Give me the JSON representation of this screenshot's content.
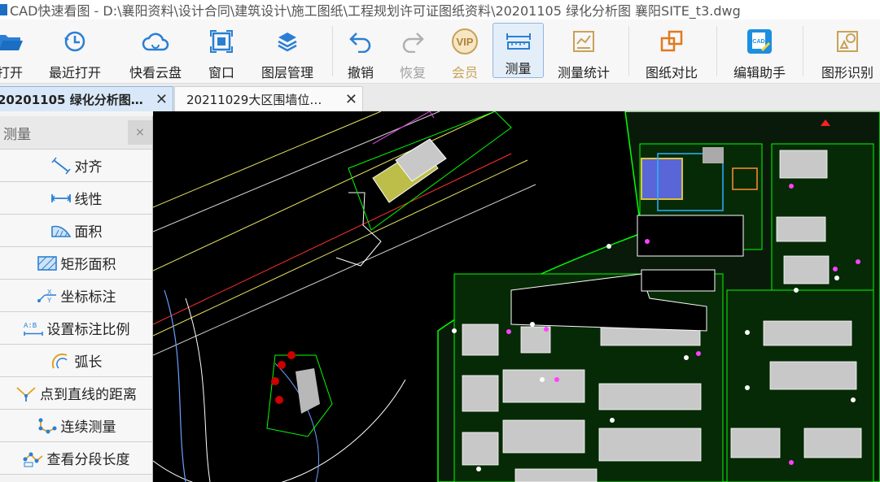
{
  "window": {
    "title": "CAD快速看图 - D:\\襄阳资料\\设计合同\\建筑设计\\施工图纸\\工程规划许可证图纸资料\\20201105 绿化分析图 襄阳SITE_t3.dwg"
  },
  "toolbar": {
    "open": "打开",
    "recent": "最近打开",
    "cloud": "快看云盘",
    "window": "窗口",
    "layers": "图层管理",
    "undo": "撤销",
    "redo": "恢复",
    "vip": "会员",
    "measure": "测量",
    "measure_stats": "测量统计",
    "compare": "图纸对比",
    "edit_helper": "编辑助手",
    "shape_recognition": "图形识别"
  },
  "tabs": [
    {
      "label": "20201105  绿化分析图…",
      "close": "✕"
    },
    {
      "label": "20211029大区围墙位…",
      "close": "✕"
    }
  ],
  "measure_panel": {
    "title": "测量",
    "close": "×",
    "items": [
      {
        "label": "对齐",
        "icon": "align-measure-icon"
      },
      {
        "label": "线性",
        "icon": "linear-measure-icon"
      },
      {
        "label": "面积",
        "icon": "area-measure-icon"
      },
      {
        "label": "矩形面积",
        "icon": "rect-area-icon"
      },
      {
        "label": "坐标标注",
        "icon": "coordinate-icon"
      },
      {
        "label": "设置标注比例",
        "icon": "scale-icon"
      },
      {
        "label": "弧长",
        "icon": "arc-length-icon"
      },
      {
        "label": "点到直线的距离",
        "icon": "point-line-distance-icon"
      },
      {
        "label": "连续测量",
        "icon": "continuous-measure-icon"
      },
      {
        "label": "查看分段长度",
        "icon": "segment-length-icon"
      }
    ]
  },
  "colors": {
    "accent": "#1b6ec2",
    "vip": "#c9a158",
    "canvas": "#000000",
    "cad_green": "#00ff00",
    "cad_gray": "#c8c8c8"
  }
}
